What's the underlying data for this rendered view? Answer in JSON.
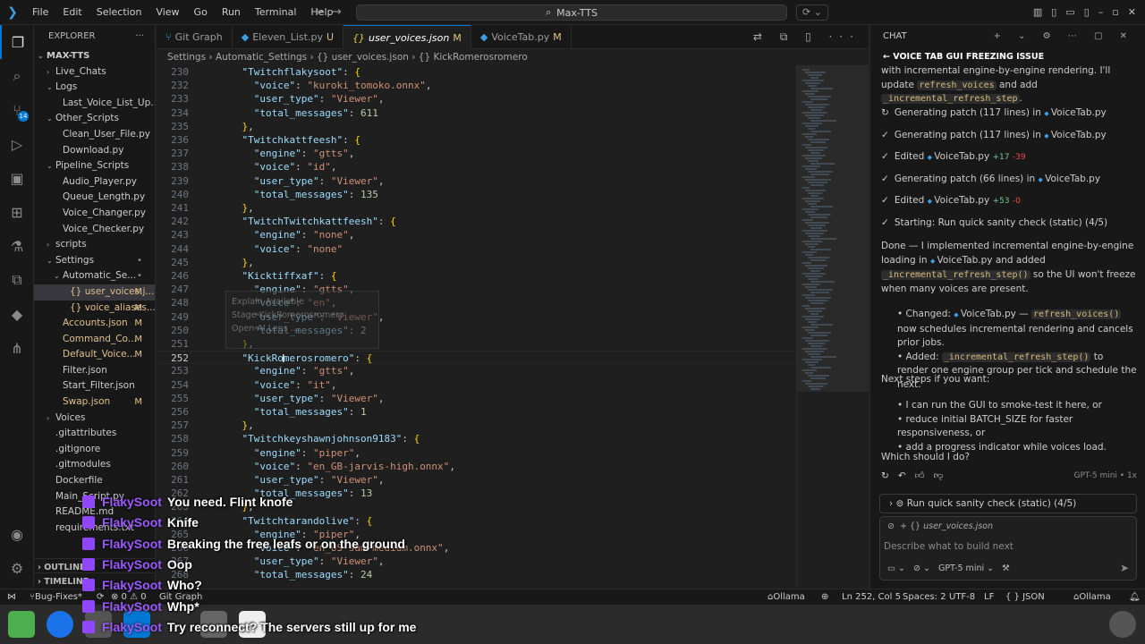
{
  "titlebar": {
    "menu": [
      "File",
      "Edit",
      "Selection",
      "View",
      "Go",
      "Run",
      "Terminal",
      "Help"
    ],
    "search": "Max-TTS"
  },
  "explorer": {
    "title": "EXPLORER",
    "root": "MAX-TTS",
    "rows": [
      {
        "label": "Live_Chats",
        "indent": 0,
        "twisty": "›",
        "mark": ""
      },
      {
        "label": "Logs",
        "indent": 0,
        "twisty": "⌄",
        "mark": ""
      },
      {
        "label": "Last_Voice_List_Up...",
        "indent": 1,
        "twisty": "",
        "mark": ""
      },
      {
        "label": "Other_Scripts",
        "indent": 0,
        "twisty": "⌄",
        "mark": ""
      },
      {
        "label": "Clean_User_File.py",
        "indent": 1,
        "twisty": "",
        "mark": ""
      },
      {
        "label": "Download.py",
        "indent": 1,
        "twisty": "",
        "mark": ""
      },
      {
        "label": "Pipeline_Scripts",
        "indent": 0,
        "twisty": "⌄",
        "mark": ""
      },
      {
        "label": "Audio_Player.py",
        "indent": 1,
        "twisty": "",
        "mark": ""
      },
      {
        "label": "Queue_Length.py",
        "indent": 1,
        "twisty": "",
        "mark": ""
      },
      {
        "label": "Voice_Changer.py",
        "indent": 1,
        "twisty": "",
        "mark": ""
      },
      {
        "label": "Voice_Checker.py",
        "indent": 1,
        "twisty": "",
        "mark": ""
      },
      {
        "label": "scripts",
        "indent": 0,
        "twisty": "›",
        "mark": ""
      },
      {
        "label": "Settings",
        "indent": 0,
        "twisty": "⌄",
        "mark": "•"
      },
      {
        "label": "Automatic_Se...",
        "indent": 1,
        "twisty": "⌄",
        "mark": "•"
      },
      {
        "label": "{} user_voices.j...",
        "indent": 2,
        "twisty": "",
        "mark": "M"
      },
      {
        "label": "{} voice_aliases...",
        "indent": 2,
        "twisty": "",
        "mark": "M"
      },
      {
        "label": "Accounts.json",
        "indent": 1,
        "twisty": "",
        "mark": "M"
      },
      {
        "label": "Command_Co...",
        "indent": 1,
        "twisty": "",
        "mark": "M"
      },
      {
        "label": "Default_Voice...",
        "indent": 1,
        "twisty": "",
        "mark": "M"
      },
      {
        "label": "Filter.json",
        "indent": 1,
        "twisty": "",
        "mark": ""
      },
      {
        "label": "Start_Filter.json",
        "indent": 1,
        "twisty": "",
        "mark": ""
      },
      {
        "label": "Swap.json",
        "indent": 1,
        "twisty": "",
        "mark": "M"
      },
      {
        "label": "Voices",
        "indent": 0,
        "twisty": "›",
        "mark": ""
      },
      {
        "label": ".gitattributes",
        "indent": 0,
        "twisty": "",
        "mark": ""
      },
      {
        "label": ".gitignore",
        "indent": 0,
        "twisty": "",
        "mark": ""
      },
      {
        "label": ".gitmodules",
        "indent": 0,
        "twisty": "",
        "mark": ""
      },
      {
        "label": "Dockerfile",
        "indent": 0,
        "twisty": "",
        "mark": ""
      },
      {
        "label": "Main_Script.py",
        "indent": 0,
        "twisty": "",
        "mark": ""
      },
      {
        "label": "README.md",
        "indent": 0,
        "twisty": "",
        "mark": ""
      },
      {
        "label": "requirements.txt",
        "indent": 0,
        "twisty": "",
        "mark": ""
      }
    ],
    "outline": "OUTLINE",
    "timeline": "TIMELINE"
  },
  "tabs": [
    {
      "label": "Git Graph",
      "state": "",
      "kind": "git"
    },
    {
      "label": "Eleven_List.py",
      "state": "U",
      "kind": "py"
    },
    {
      "label": "user_voices.json",
      "state": "M",
      "kind": "json"
    },
    {
      "label": "VoiceTab.py",
      "state": "M",
      "kind": "py"
    }
  ],
  "breadcrumb": "Settings › Automatic_Settings › {} user_voices.json › {} KickRomerosromero",
  "editor": {
    "lines": [
      {
        "n": "230",
        "t": "    \"Twitchflakysoot\": {"
      },
      {
        "n": "232",
        "t": "      \"voice\": \"kuroki_tomoko.onnx\","
      },
      {
        "n": "233",
        "t": "      \"user_type\": \"Viewer\","
      },
      {
        "n": "234",
        "t": "      \"total_messages\": 611"
      },
      {
        "n": "235",
        "t": "    },"
      },
      {
        "n": "236",
        "t": "    \"Twitchkattfeesh\": {"
      },
      {
        "n": "237",
        "t": "      \"engine\": \"gtts\","
      },
      {
        "n": "238",
        "t": "      \"voice\": \"id\","
      },
      {
        "n": "239",
        "t": "      \"user_type\": \"Viewer\","
      },
      {
        "n": "240",
        "t": "      \"total_messages\": 135"
      },
      {
        "n": "241",
        "t": "    },"
      },
      {
        "n": "242",
        "t": "    \"TwitchTwitchkattfeesh\": {"
      },
      {
        "n": "243",
        "t": "      \"engine\": \"none\","
      },
      {
        "n": "244",
        "t": "      \"voice\": \"none\""
      },
      {
        "n": "245",
        "t": "    },"
      },
      {
        "n": "246",
        "t": "    \"Kicktiffxaf\": {"
      },
      {
        "n": "247",
        "t": "      \"engine\": \"gtts\","
      },
      {
        "n": "248",
        "t": "      \"voice\": \"en\","
      },
      {
        "n": "249",
        "t": "      \"user_type\": \"Viewer\","
      },
      {
        "n": "250",
        "t": "      \"total_messages\": 2"
      },
      {
        "n": "251",
        "t": "    },"
      },
      {
        "n": "252",
        "t": "    \"KickRomerosromero\": {"
      },
      {
        "n": "253",
        "t": "      \"engine\": \"gtts\","
      },
      {
        "n": "254",
        "t": "      \"voice\": \"it\","
      },
      {
        "n": "255",
        "t": "      \"user_type\": \"Viewer\","
      },
      {
        "n": "256",
        "t": "      \"total_messages\": 1"
      },
      {
        "n": "257",
        "t": "    },"
      },
      {
        "n": "258",
        "t": "    \"Twitchkeyshawnjohnson9183\": {"
      },
      {
        "n": "259",
        "t": "      \"engine\": \"piper\","
      },
      {
        "n": "260",
        "t": "      \"voice\": \"en_GB-jarvis-high.onnx\","
      },
      {
        "n": "261",
        "t": "      \"user_type\": \"Viewer\","
      },
      {
        "n": "262",
        "t": "      \"total_messages\": 13"
      },
      {
        "n": "263",
        "t": "    },"
      },
      {
        "n": "264",
        "t": "    \"Twitchtarandolive\": {"
      },
      {
        "n": "265",
        "t": "      \"engine\": \"piper\","
      },
      {
        "n": "266",
        "t": "      \"voice\": \"en_US-sam-medium.onnx\","
      },
      {
        "n": "267",
        "t": "      \"user_type\": \"Viewer\","
      },
      {
        "n": "268",
        "t": "      \"total_messages\": 24"
      }
    ],
    "current_line": "252",
    "ghost_lines": [
      "Explain Available",
      "Stage KickRomerosromero",
      "Open AI Lens ..."
    ]
  },
  "chat": {
    "header": "CHAT",
    "title": "VOICE TAB GUI FREEZING ISSUE",
    "intro_a": "with incremental engine-by-engine rendering. I'll update",
    "intro_code1": "refresh_voices",
    "intro_b": "and add",
    "intro_code2": "_incremental_refresh_step",
    "steps": [
      {
        "icon": "↻",
        "text": "Generating patch (117 lines) in",
        "file": "VoiceTab.py",
        "plus": "",
        "minus": ""
      },
      {
        "icon": "✓",
        "text": "Generating patch (117 lines) in",
        "file": "VoiceTab.py",
        "plus": "",
        "minus": ""
      },
      {
        "icon": "✓",
        "text": "Edited",
        "file": "VoiceTab.py",
        "plus": "+17",
        "minus": "-39"
      },
      {
        "icon": "✓",
        "text": "Generating patch (66 lines) in",
        "file": "VoiceTab.py",
        "plus": "",
        "minus": ""
      },
      {
        "icon": "✓",
        "text": "Edited",
        "file": "VoiceTab.py",
        "plus": "+53",
        "minus": "-0"
      },
      {
        "icon": "✓",
        "text": "Starting: Run quick sanity check (static) (4/5)",
        "file": "",
        "plus": "",
        "minus": ""
      }
    ],
    "done_a": "Done — I implemented incremental engine-by-engine loading in",
    "done_file": "VoiceTab.py",
    "done_b": "and added",
    "done_code": "_incremental_refresh_step()",
    "done_c": "so the UI won't freeze when many voices are present.",
    "changed_label": "Changed:",
    "changed_file": "VoiceTab.py",
    "changed_dash": "—",
    "changed_code": "refresh_voices()",
    "changed_text": "now schedules incremental rendering and cancels prior jobs.",
    "added_label": "Added:",
    "added_code": "_incremental_refresh_step()",
    "added_text": "to render one engine group per tick and schedule the next.",
    "next_title": "Next steps if you want:",
    "next_items": [
      "I can run the GUI to smoke-test it here, or",
      "reduce initial BATCH_SIZE for faster responsiveness, or",
      "add a progress indicator while voices load."
    ],
    "question": "Which should I do?",
    "model_tag": "GPT-5 mini • 1x",
    "tool_bar": "Run quick sanity check (static) (4/5)",
    "attachment": "user_voices.json",
    "placeholder": "Describe what to build next",
    "model_select": "GPT-5 mini"
  },
  "statusbar": {
    "branch": "Bug-Fixes*",
    "problems": "⊗ 0 ⚠ 0",
    "git_graph": "Git Graph",
    "ollama1": "Ollama",
    "position": "Ln 252, Col 5",
    "spaces": "Spaces: 2",
    "encoding": "UTF-8",
    "eol": "LF",
    "language": "{ } JSON",
    "ollama2": "Ollama"
  },
  "stream_chat": [
    {
      "user": "FlakySoot",
      "text": "You need. Flint knofe"
    },
    {
      "user": "FlakySoot",
      "text": "Knife"
    },
    {
      "user": "FlakySoot",
      "text": "Breaking the free leafs or on the ground"
    },
    {
      "user": "FlakySoot",
      "text": "Oop"
    },
    {
      "user": "FlakySoot",
      "text": "Who?"
    },
    {
      "user": "FlakySoot",
      "text": "Whp*"
    },
    {
      "user": "FlakySoot",
      "text": "Try reconnect? The servers still up for me"
    }
  ],
  "colors": {
    "accent": "#0078d4",
    "json_key": "#9cdcfe",
    "json_string": "#ce9178",
    "json_number": "#b5cea8",
    "modified": "#e2c08d",
    "twitch": "#9146ff"
  }
}
